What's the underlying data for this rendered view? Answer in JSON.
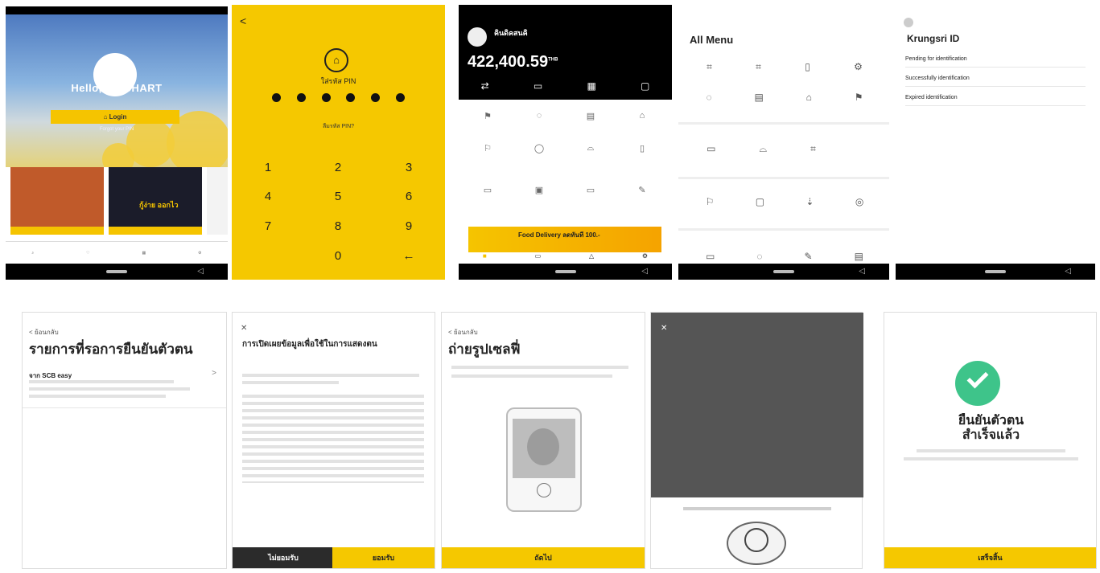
{
  "panel1": {
    "status": "",
    "greeting": "Hello, APICHART",
    "login_label": "Login",
    "forgot": "Forgot your PIN",
    "promo1_text": "",
    "promo2_text": "กู้ง่าย ออกไว"
  },
  "panel2": {
    "back": "<",
    "title": "ใส่รหัส PIN",
    "forgot": "ลืมรหัส PIN?",
    "keys": [
      "1",
      "2",
      "3",
      "4",
      "5",
      "6",
      "7",
      "8",
      "9",
      "0",
      "←"
    ]
  },
  "panel3": {
    "name": "คินดิคสนคิ",
    "balance": "422,400.59",
    "balance_unit": "THB",
    "promo": "Food Delivery ลดทันที 100.-"
  },
  "panel4": {
    "title": "All Menu"
  },
  "panel5": {
    "title": "Krungsri ID",
    "items": [
      "Pending for identification",
      "Successfully identification",
      "Expired identification"
    ]
  },
  "bottom1": {
    "back": "< ย้อนกลับ",
    "title": "รายการที่รอการยืนยันตัวตน",
    "item_title": "จาก SCB easy",
    "item_arrow": ">"
  },
  "bottom2": {
    "close": "✕",
    "title": "การเปิดเผยข้อมูลเพื่อใช้ในการแสดงตน",
    "btn_decline": "ไม่ยอมรับ",
    "btn_accept": "ยอมรับ"
  },
  "bottom3": {
    "back": "< ย้อนกลับ",
    "title": "ถ่ายรูปเซลฟี่",
    "btn": "ถัดไป"
  },
  "bottom4": {
    "close": "✕",
    "caption": ""
  },
  "bottom5": {
    "title_line1": "ยืนยันตัวตน",
    "title_line2": "สำเร็จแล้ว",
    "btn": "เสร็จสิ้น"
  },
  "colors": {
    "brand_yellow": "#f5c800",
    "success_green": "#3ec48a",
    "dark": "#000000"
  }
}
